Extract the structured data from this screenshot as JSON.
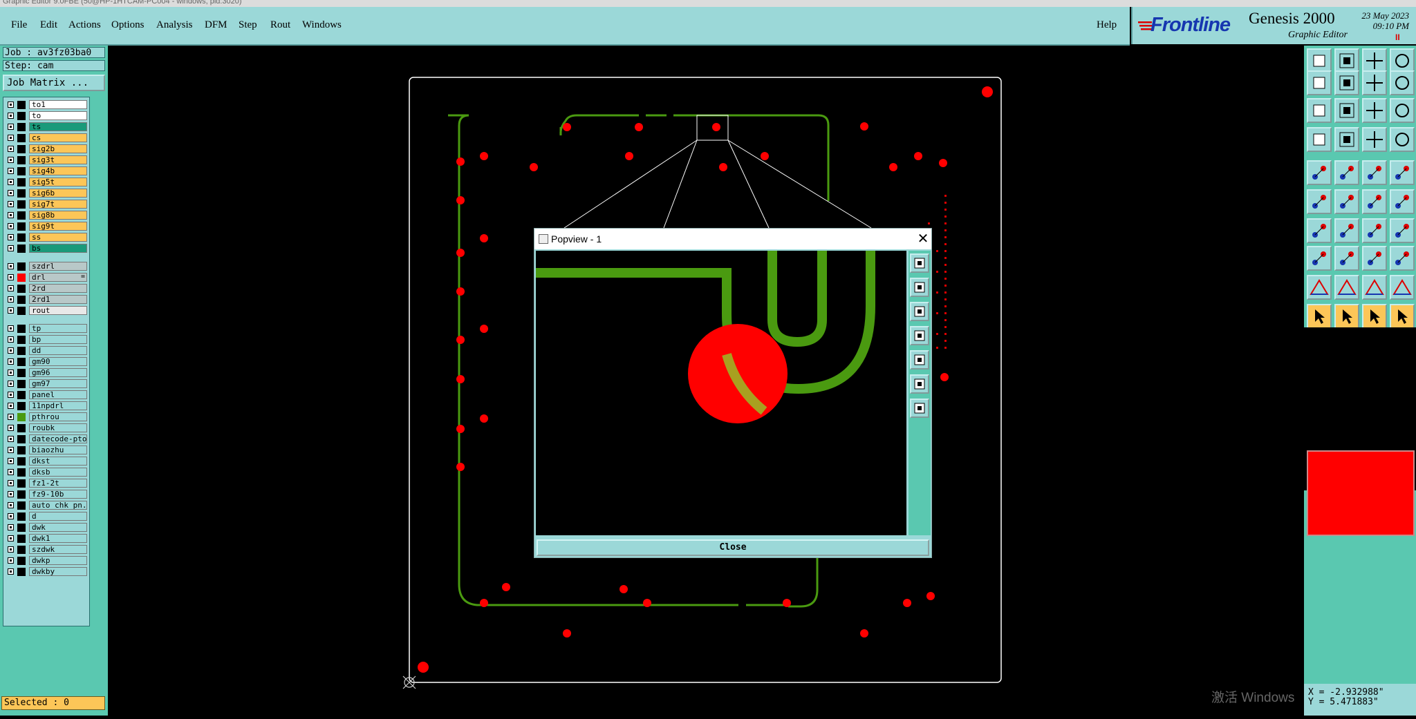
{
  "window_title": "Graphic Editor 9.0FBE (50@HP-1HTCAM-PC004 - windows, pid:3020)",
  "menu": {
    "file": "File",
    "edit": "Edit",
    "actions": "Actions",
    "options": "Options",
    "analysis": "Analysis",
    "dfm": "DFM",
    "step": "Step",
    "rout": "Rout",
    "windows": "Windows",
    "help": "Help"
  },
  "brand": {
    "logo": "Frontline",
    "product": "Genesis 2000",
    "subtitle": "Graphic Editor",
    "date": "23 May 2023",
    "time": "09:10 PM",
    "rec_indicator": "II"
  },
  "job_info": {
    "job": "Job : av3fz03ba0",
    "step": "Step: cam",
    "job_matrix_button": "Job Matrix ..."
  },
  "layers": [
    {
      "name": "to1",
      "color": "#ffffff",
      "group": 0
    },
    {
      "name": "to",
      "color": "#ffffff",
      "group": 0
    },
    {
      "name": "ts",
      "color": "#1a9a7a",
      "group": 0
    },
    {
      "name": "cs",
      "color": "#fcc658",
      "group": 0
    },
    {
      "name": "sig2b",
      "color": "#fcc658",
      "group": 0
    },
    {
      "name": "sig3t",
      "color": "#fcc658",
      "group": 0
    },
    {
      "name": "sig4b",
      "color": "#fcc658",
      "group": 0
    },
    {
      "name": "sig5t",
      "color": "#fcc658",
      "group": 0
    },
    {
      "name": "sig6b",
      "color": "#fcc658",
      "group": 0
    },
    {
      "name": "sig7t",
      "color": "#fcc658",
      "group": 0
    },
    {
      "name": "sig8b",
      "color": "#fcc658",
      "group": 0
    },
    {
      "name": "sig9t",
      "color": "#fcc658",
      "group": 0
    },
    {
      "name": "ss",
      "color": "#fcc658",
      "group": 0
    },
    {
      "name": "bs",
      "color": "#1a9a7a",
      "group": 0
    },
    {
      "name": "szdrl",
      "color": "#b8c8c8",
      "group": 1
    },
    {
      "name": "drl",
      "color": "#b8c8c8",
      "group": 1,
      "swatch": "#ff0000",
      "active": true,
      "suffix": "="
    },
    {
      "name": "2rd",
      "color": "#b8c8c8",
      "group": 1
    },
    {
      "name": "2rd1",
      "color": "#b8c8c8",
      "group": 1
    },
    {
      "name": "rout",
      "color": "#e8e8e8",
      "group": 1
    },
    {
      "name": "tp",
      "color": "#9bd8d8",
      "group": 2
    },
    {
      "name": "bp",
      "color": "#9bd8d8",
      "group": 2
    },
    {
      "name": "dd",
      "color": "#9bd8d8",
      "group": 2
    },
    {
      "name": "gm90",
      "color": "#9bd8d8",
      "group": 2
    },
    {
      "name": "gm96",
      "color": "#9bd8d8",
      "group": 2
    },
    {
      "name": "gm97",
      "color": "#9bd8d8",
      "group": 2
    },
    {
      "name": "panel",
      "color": "#9bd8d8",
      "group": 2
    },
    {
      "name": "11npdrl",
      "color": "#9bd8d8",
      "group": 2
    },
    {
      "name": "pthrou",
      "color": "#9bd8d8",
      "group": 2,
      "swatch": "#4a9a10"
    },
    {
      "name": "roubk",
      "color": "#9bd8d8",
      "group": 2
    },
    {
      "name": "datecode-pto",
      "color": "#9bd8d8",
      "group": 2
    },
    {
      "name": "biaozhu",
      "color": "#9bd8d8",
      "group": 2
    },
    {
      "name": "dkst",
      "color": "#9bd8d8",
      "group": 2
    },
    {
      "name": "dksb",
      "color": "#9bd8d8",
      "group": 2
    },
    {
      "name": "fz1-2t",
      "color": "#9bd8d8",
      "group": 2
    },
    {
      "name": "fz9-10b",
      "color": "#9bd8d8",
      "group": 2
    },
    {
      "name": "auto_chk_pn.",
      "color": "#9bd8d8",
      "group": 2
    },
    {
      "name": "d",
      "color": "#9bd8d8",
      "group": 2
    },
    {
      "name": "dwk",
      "color": "#9bd8d8",
      "group": 2
    },
    {
      "name": "dwk1",
      "color": "#9bd8d8",
      "group": 2
    },
    {
      "name": "szdwk",
      "color": "#9bd8d8",
      "group": 2
    },
    {
      "name": "dwkp",
      "color": "#9bd8d8",
      "group": 2
    },
    {
      "name": "dwkby",
      "color": "#9bd8d8",
      "group": 2
    }
  ],
  "status": {
    "selected": "Selected : 0"
  },
  "coordinates": {
    "x": "X = -2.932988\"",
    "y": "Y = 5.471883\""
  },
  "popview": {
    "title": "Popview - 1",
    "close_label": "Close"
  },
  "toolbar_icons": [
    "zoom-home-icon",
    "zoom-out-icon",
    "home-icon",
    "window-layout-icon",
    "pan-left-icon",
    "pan-right-icon",
    "redraw-icon",
    "undo-icon",
    "fit-screen-icon",
    "zoom-fit-icon",
    "ratio-icon",
    "help-icon",
    "snap-icon",
    "grid-icon",
    "net-icon",
    "net-compare-icon",
    "pad-add-icon",
    "line-add-icon",
    "measure-icon",
    "circle-icon",
    "move-icon",
    "delete-icon",
    "copy-icon",
    "resize-icon",
    "angle-icon",
    "line-edit-icon",
    "arc-icon",
    "mirror-icon",
    "feature-select-icon",
    "trim-icon",
    "dimension-icon",
    "attribute-icon",
    "surface-icon",
    "outline-icon",
    "surface-fill-icon",
    "surface-edit-icon",
    "select-arrow-icon",
    "select-plus-icon",
    "select-cursor-icon",
    "route-icon"
  ],
  "popview_tool_icons": [
    "pv-fit-icon",
    "pv-zoom-in-icon",
    "pv-zoom-out-icon",
    "pv-pan-left-icon",
    "pv-pan-right-icon",
    "pv-zoom-window-icon",
    "pv-center-icon"
  ],
  "watermark": {
    "text": "激活 Windows"
  },
  "colors": {
    "background": "#000000",
    "panel": "#5ac8b0",
    "menubar": "#9bd8d8",
    "profile": "#ffffff",
    "trace": "#4a9a10",
    "drill": "#ff0000",
    "accent_logo": "#1636b0"
  }
}
